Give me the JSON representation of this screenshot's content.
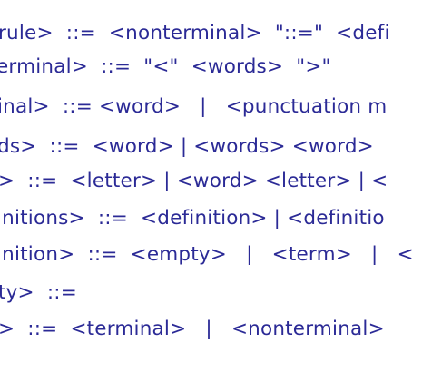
{
  "document": {
    "lines": [
      "rule>  ::=  <nonterminal>  \"::=\"  <defi",
      "erminal>  ::=  \"<\"  <words>  \">\"",
      "inal>  ::= <word>   |   <punctuation m",
      "ds>  ::=  <word> | <words> <word>",
      ">  ::=  <letter> | <word> <letter> | <",
      "initions>  ::=  <definition> | <definitio",
      "inition>  ::=  <empty>   |   <term>   |   <",
      "ty>  ::=",
      ">  ::=  <terminal>   |   <nonterminal>"
    ]
  }
}
